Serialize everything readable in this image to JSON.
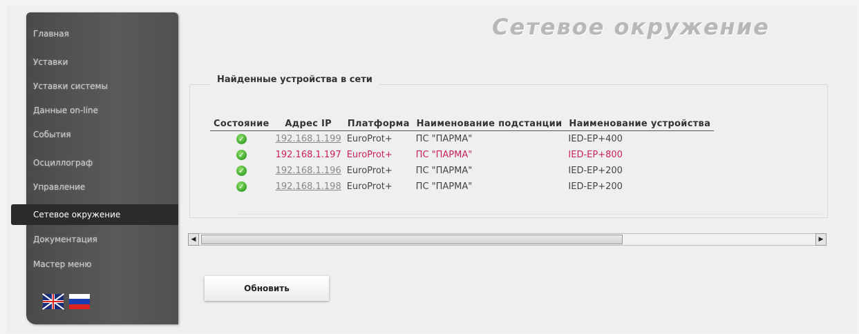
{
  "header": {
    "title": "Сетевое окружение"
  },
  "sidebar": {
    "items": [
      {
        "label": "Главная"
      },
      {
        "label": "Уставки"
      },
      {
        "label": "Уставки системы"
      },
      {
        "label": "Данные on-line"
      },
      {
        "label": "События"
      },
      {
        "label": "Осциллограф"
      },
      {
        "label": "Управление"
      },
      {
        "label": "Сетевое окружение",
        "active": true
      },
      {
        "label": "Документация"
      },
      {
        "label": "Мастер меню"
      }
    ],
    "languages": [
      {
        "icon": "uk-flag-icon"
      },
      {
        "icon": "ru-flag-icon"
      }
    ]
  },
  "devices": {
    "legend": "Найденные устройства в сети",
    "columns": [
      "Состояние",
      "Адрес IP",
      "Платформа",
      "Наименование подстанции",
      "Наименование устройства"
    ],
    "rows": [
      {
        "status_icon": "check-circle-icon",
        "ip": "192.168.1.199",
        "platform": "EuroProt+",
        "substation": "ПС \"ПАРМА\"",
        "device": "IED-EP+400",
        "highlighted": false
      },
      {
        "status_icon": "check-circle-icon",
        "ip": "192.168.1.197",
        "platform": "EuroProt+",
        "substation": "ПС \"ПАРМА\"",
        "device": "IED-EP+800",
        "highlighted": true
      },
      {
        "status_icon": "check-circle-icon",
        "ip": "192.168.1.196",
        "platform": "EuroProt+",
        "substation": "ПС \"ПАРМА\"",
        "device": "IED-EP+200",
        "highlighted": false
      },
      {
        "status_icon": "check-circle-icon",
        "ip": "192.168.1.198",
        "platform": "EuroProt+",
        "substation": "ПС \"ПАРМА\"",
        "device": "IED-EP+200",
        "highlighted": false
      }
    ]
  },
  "actions": {
    "refresh_label": "Обновить"
  },
  "colors": {
    "highlight": "#cc2255",
    "sidebar": "#555555",
    "active_item": "#2b2b2b",
    "title": "#b8b8b8"
  }
}
